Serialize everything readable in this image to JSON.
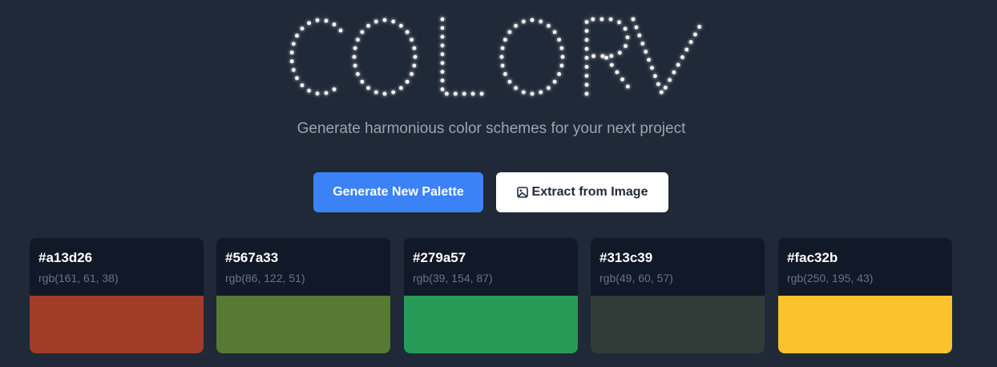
{
  "app": {
    "logo_text": "COLORV",
    "subtitle": "Generate harmonious color schemes for your next project"
  },
  "actions": {
    "generate_label": "Generate New Palette",
    "extract_label": "Extract from Image",
    "extract_icon": "image-icon"
  },
  "colors": {
    "accent": "#3b82f6",
    "background": "#1f2937",
    "card_background": "#111827"
  },
  "palette": [
    {
      "hex": "#a13d26",
      "rgb": "rgb(161, 61, 38)"
    },
    {
      "hex": "#567a33",
      "rgb": "rgb(86, 122, 51)"
    },
    {
      "hex": "#279a57",
      "rgb": "rgb(39, 154, 87)"
    },
    {
      "hex": "#313c39",
      "rgb": "rgb(49, 60, 57)"
    },
    {
      "hex": "#fac32b",
      "rgb": "rgb(250, 195, 43)"
    }
  ]
}
